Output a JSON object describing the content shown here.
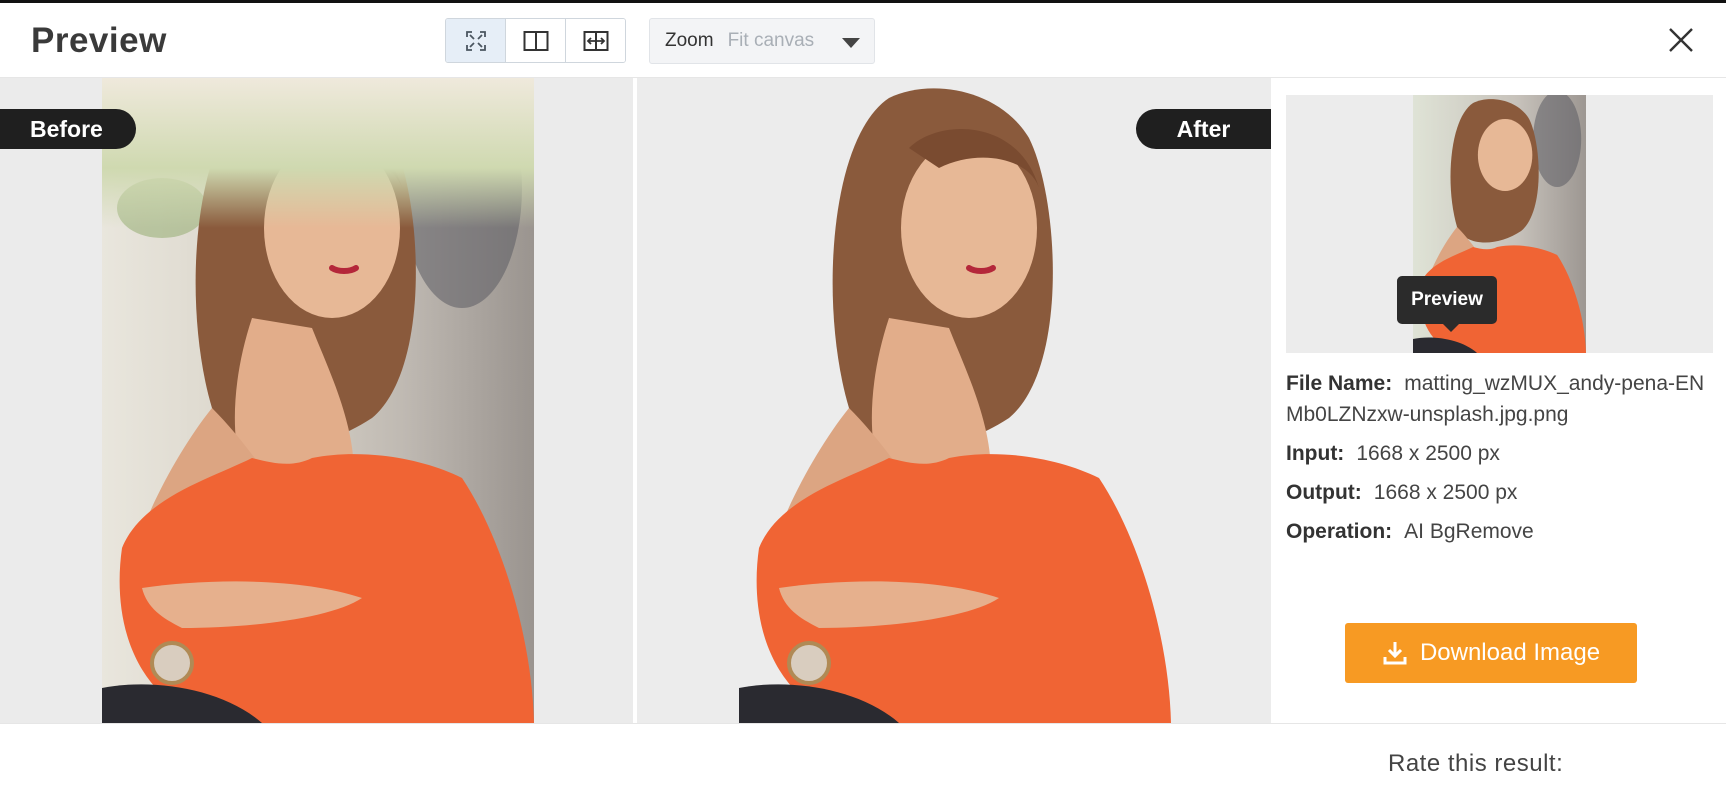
{
  "header": {
    "title": "Preview",
    "view_modes": [
      "fit-screen",
      "side-by-side",
      "split-compare"
    ],
    "active_view": "fit-screen",
    "zoom_label": "Zoom",
    "zoom_value": "Fit canvas"
  },
  "compare": {
    "before_label": "Before",
    "after_label": "After"
  },
  "sidebar": {
    "thumbnail_tooltip": "Preview",
    "file_name_key": "File Name:",
    "file_name_value": "matting_wzMUX_andy-pena-ENMb0LZNzxw-unsplash.jpg.png",
    "input_key": "Input:",
    "input_value": "1668 x 2500 px",
    "output_key": "Output:",
    "output_value": "1668 x 2500 px",
    "operation_key": "Operation:",
    "operation_value": "AI BgRemove",
    "download_label": "Download Image"
  },
  "footer": {
    "rate_label": "Rate this result:"
  },
  "colors": {
    "accent": "#f79a23",
    "tag_bg": "#1f1f1f",
    "active_view_bg": "#e6eef7",
    "canvas_bg": "#ebebeb"
  }
}
